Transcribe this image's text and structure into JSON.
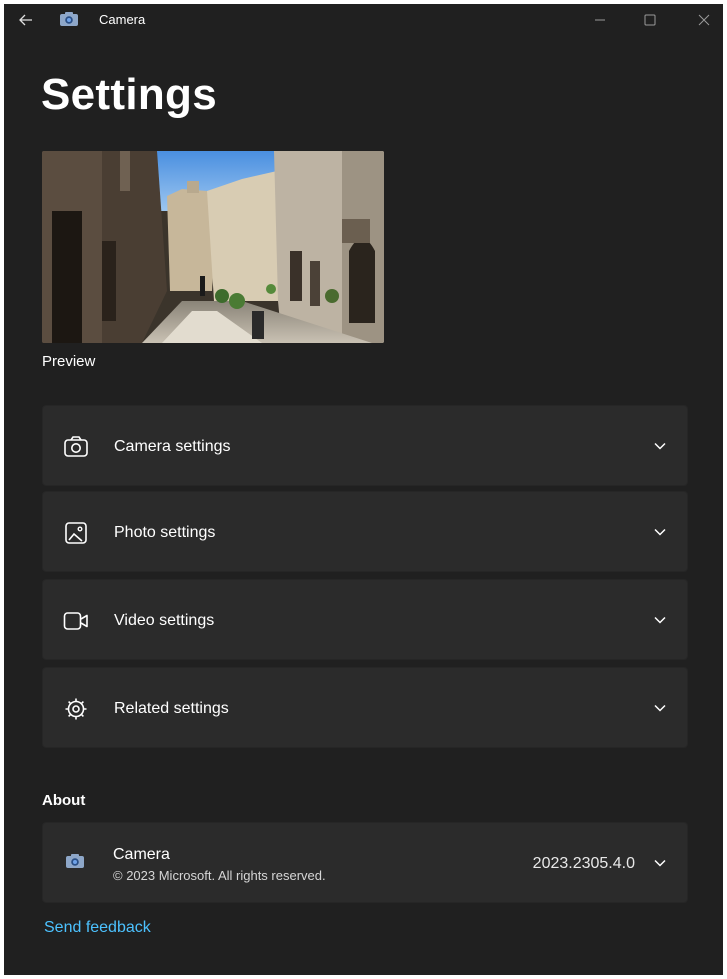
{
  "titlebar": {
    "app_title": "Camera",
    "icons": [
      "back-arrow-icon",
      "camera-app-icon",
      "minimize-icon",
      "maximize-icon",
      "close-icon"
    ]
  },
  "page": {
    "title": "Settings"
  },
  "preview": {
    "label": "Preview"
  },
  "sections": [
    {
      "label": "Camera settings",
      "icon": "camera-icon"
    },
    {
      "label": "Photo settings",
      "icon": "photo-icon"
    },
    {
      "label": "Video settings",
      "icon": "video-icon"
    },
    {
      "label": "Related settings",
      "icon": "gear-icon"
    }
  ],
  "about": {
    "heading": "About",
    "app_name": "Camera",
    "copyright": "© 2023 Microsoft. All rights reserved.",
    "version": "2023.2305.4.0"
  },
  "footer": {
    "feedback_link": "Send feedback"
  },
  "colors": {
    "background": "#202020",
    "card": "#2b2b2b",
    "link": "#4cc2ff",
    "text": "#ffffff"
  }
}
